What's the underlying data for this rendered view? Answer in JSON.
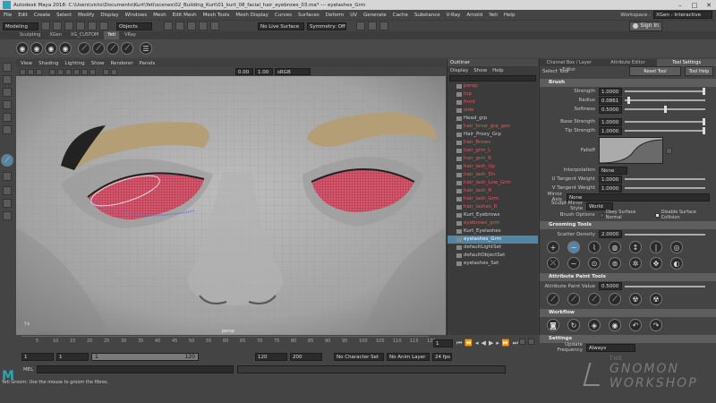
{
  "title_bar": {
    "text": "Autodesk Maya 2018: C:\\Users\\victo\\Documents\\Kurt\\Yeti\\scenes\\02_Building_Kurt\\01_kurt_08_facial_hair_eyebrows_03.ma* --- eyelashes_Grm"
  },
  "menu": [
    "File",
    "Edit",
    "Create",
    "Select",
    "Modify",
    "Display",
    "Windows",
    "Mesh",
    "Edit Mesh",
    "Mesh Tools",
    "Mesh Display",
    "Curves",
    "Surfaces",
    "Deform",
    "UV",
    "Generate",
    "Cache",
    "Substance",
    "V-Ray",
    "Arnold",
    "Yeti",
    "Help"
  ],
  "workspace": {
    "label": "Workspace :",
    "value": "XGen - Interactive Groom*"
  },
  "sign_in": "Sign In",
  "status": {
    "mode": "Modeling",
    "objects": "Objects",
    "live": "No Live Surface",
    "symmetry": "Symmetry: Off"
  },
  "shelf_tabs": [
    "Sculpting",
    "XGen",
    "XG_CUSTOM",
    "Yeti",
    "VRay"
  ],
  "shelf_active": "Yeti",
  "viewport": {
    "menu": [
      "View",
      "Shading",
      "Lighting",
      "Show",
      "Renderer",
      "Panels"
    ],
    "num1": "0.00",
    "num2": "1.00",
    "colorspace": "sRGB gamma",
    "cam": "persp"
  },
  "outliner": {
    "title": "Outliner",
    "menu": [
      "Display",
      "Show",
      "Help"
    ],
    "items": [
      {
        "label": "persp",
        "red": true
      },
      {
        "label": "top",
        "red": true
      },
      {
        "label": "front",
        "red": true
      },
      {
        "label": "side",
        "red": true
      },
      {
        "label": "Head_grp",
        "red": false
      },
      {
        "label": "hair_brow_grp_geo",
        "red": true
      },
      {
        "label": "Hair_Proxy_Grp",
        "red": false
      },
      {
        "label": "hair_Brows",
        "red": true
      },
      {
        "label": "hair_grm_L",
        "red": true
      },
      {
        "label": "hair_grm_R",
        "red": true
      },
      {
        "label": "hair_lash_Up",
        "red": true
      },
      {
        "label": "hair_lash_Dn",
        "red": true
      },
      {
        "label": "hair_lash_Low_Grm",
        "red": true
      },
      {
        "label": "hair_lash_R",
        "red": true
      },
      {
        "label": "hair_lash_Grm",
        "red": true
      },
      {
        "label": "hair_lashes_R",
        "red": true
      },
      {
        "label": "Kurt_Eyebrows",
        "red": false
      },
      {
        "label": "eyebrows_grm",
        "red": true
      },
      {
        "label": "Kurt_Eyelashes",
        "red": false
      },
      {
        "label": "eyelashes_Grm",
        "red": false,
        "selected": true
      },
      {
        "label": "defaultLightSet",
        "red": false
      },
      {
        "label": "defaultObjectSet",
        "red": false
      },
      {
        "label": "eyelashes_Set",
        "red": false
      }
    ]
  },
  "right_tabs": [
    "Channel Box / Layer Editor",
    "Attribute Editor",
    "Tool Settings"
  ],
  "tool": {
    "name": "Select Tool",
    "reset": "Reset Tool",
    "help": "Tool Help"
  },
  "brush": {
    "title": "Brush",
    "fields": [
      {
        "label": "Strength",
        "value": "1.0000",
        "fill": 1.0
      },
      {
        "label": "Radius",
        "value": "0.0861",
        "fill": 0.04
      },
      {
        "label": "Softness",
        "value": "0.5000",
        "fill": 0.5
      },
      {
        "label": "Base Strength",
        "value": "1.0000",
        "fill": 1.0
      },
      {
        "label": "Tip Strength",
        "value": "1.0000",
        "fill": 1.0
      }
    ],
    "falloff": "Falloff",
    "interp_label": "Interpolation",
    "interp_value": "None",
    "u_label": "U Tangent Weight",
    "u_value": "1.0000",
    "v_label": "V Tangent Weight",
    "v_value": "1.0000",
    "mirror_label": "Mirror Axis",
    "mirror_value": "None",
    "sculpt_label": "Sculpt Mirror Style",
    "sculpt_value": "World",
    "opt_label": "Brush Options",
    "opt1": "Obey Surface Normal",
    "opt2": "Disable Surface Collision"
  },
  "grooming": {
    "title": "Grooming Tools",
    "scatter_label": "Scatter Density",
    "scatter_value": "2.0000"
  },
  "attr_paint": {
    "title": "Attribute Paint Tools",
    "label": "Attribute Paint Value",
    "value": "0.5000"
  },
  "workflow": {
    "title": "Workflow"
  },
  "settings": {
    "title": "Settings",
    "label": "Update Frequency",
    "value": "Always"
  },
  "timeline": {
    "ticks": [
      "5",
      "10",
      "15",
      "20",
      "25",
      "30",
      "35",
      "40",
      "45",
      "50",
      "55",
      "60",
      "65",
      "70",
      "75",
      "80",
      "85",
      "90",
      "95",
      "100",
      "105",
      "110",
      "115",
      "120"
    ],
    "current": "1",
    "start": "1",
    "start2": "1",
    "range_start": "1",
    "range_end": "120",
    "end": "120",
    "end2": "200",
    "character": "No Character Set",
    "anim": "No Anim Layer",
    "fps": "24 fps"
  },
  "mel": {
    "label": "MEL",
    "help": "Yeti Groom: Use the mouse to groom the fibres."
  },
  "watermark": {
    "line1": "THE",
    "line2": "GNOMON",
    "line3": "WORKSHOP"
  },
  "colors": {
    "accent": "#5285a6",
    "red_item": "#e35b5b",
    "lash_pink": "#d9576e"
  }
}
